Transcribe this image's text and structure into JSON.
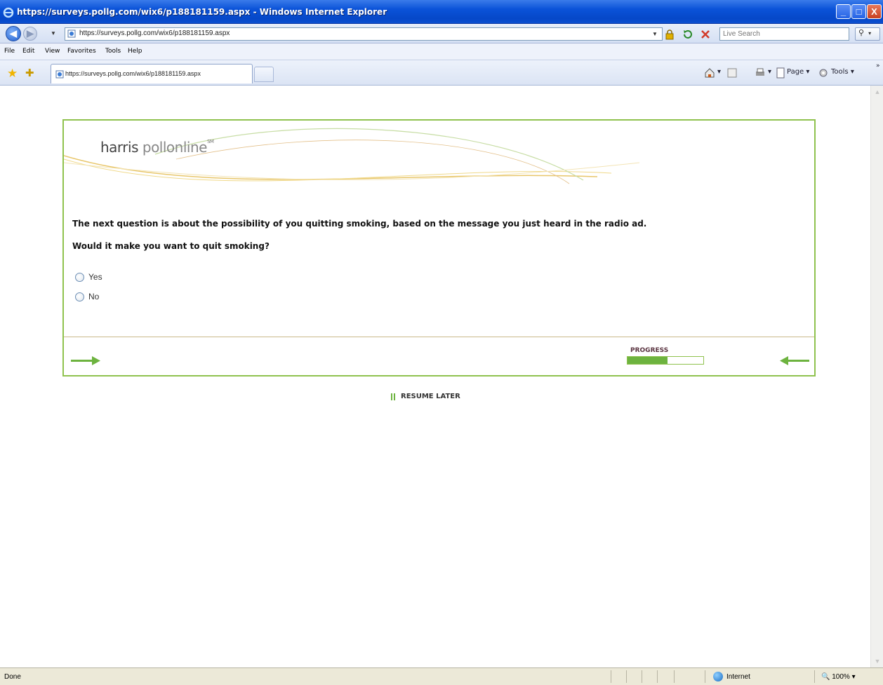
{
  "window": {
    "title": "https://surveys.pollg.com/wix6/p188181159.aspx - Windows Internet Explorer",
    "controls": {
      "minimize": "_",
      "maximize": "□",
      "close": "X"
    }
  },
  "address_bar": {
    "url": "https://surveys.pollg.com/wix6/p188181159.aspx",
    "search_placeholder": "Live Search"
  },
  "menu": {
    "items": [
      "File",
      "Edit",
      "View",
      "Favorites",
      "Tools",
      "Help"
    ]
  },
  "tabs": {
    "active_tab_title": "https://surveys.pollg.com/wix6/p188181159.aspx"
  },
  "command_bar": {
    "page": "Page ▾",
    "tools": "Tools ▾"
  },
  "survey": {
    "logo": {
      "brand": "harris",
      "poll": "poll",
      "online": "online",
      "mark": "SM"
    },
    "intro": "The next question is about the possibility of you quitting smoking, based on the message you just heard in the radio ad.",
    "question": "Would it make you want to quit smoking?",
    "options": [
      "Yes",
      "No"
    ],
    "progress_label": "PROGRESS",
    "progress_fraction": 0.53,
    "resume_label": "RESUME LATER"
  },
  "status_bar": {
    "status_text": "Done",
    "zone": "Internet",
    "zoom": "100%"
  },
  "colors": {
    "accent_green": "#8fc24e",
    "progress_fill": "#6db33f",
    "title_blue": "#0a52d8"
  }
}
